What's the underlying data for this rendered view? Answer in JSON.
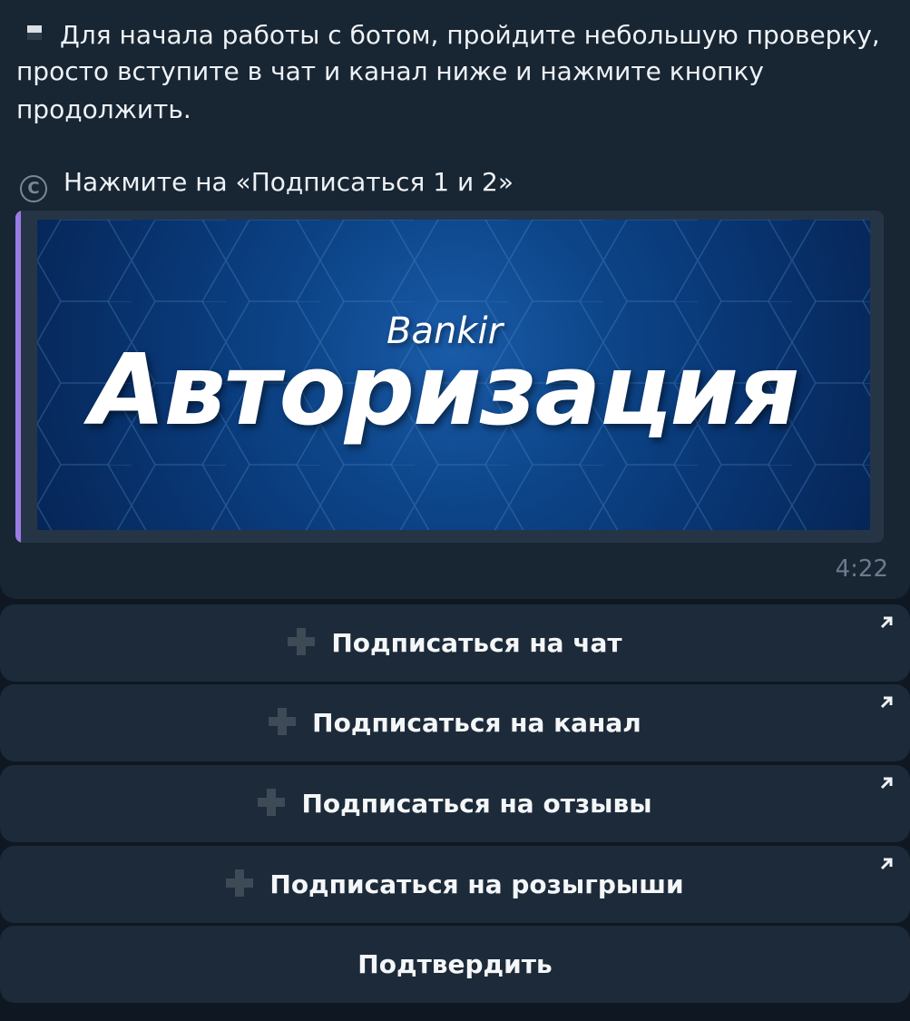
{
  "message": {
    "lines": [
      "Для начала работы с ботом, пройдите небольшую проверку,",
      "просто вступите в чат и канал ниже и нажмите кнопку",
      "продолжить."
    ],
    "note": "Нажмите на «Подписаться 1 и 2»",
    "banner": {
      "small_text": "Bankir",
      "big_text": "Авторизация"
    },
    "time": "4:22",
    "copyright_glyph": "C",
    "accent_color": "#9b7ce4"
  },
  "buttons": [
    {
      "label": "Подписаться на чат",
      "icon": "plus-icon",
      "external": true
    },
    {
      "label": "Подписаться на канал",
      "icon": "plus-icon",
      "external": true
    },
    {
      "label": "Подписаться на отзывы",
      "icon": "plus-icon",
      "external": true
    },
    {
      "label": "Подписаться на розыгрыши",
      "icon": "plus-icon",
      "external": true
    },
    {
      "label": "Подтвердить"
    }
  ],
  "colors": {
    "background": "#0f1822",
    "bubble": "#182533",
    "button": "#1c2a39",
    "time": "#6b7b8c"
  }
}
